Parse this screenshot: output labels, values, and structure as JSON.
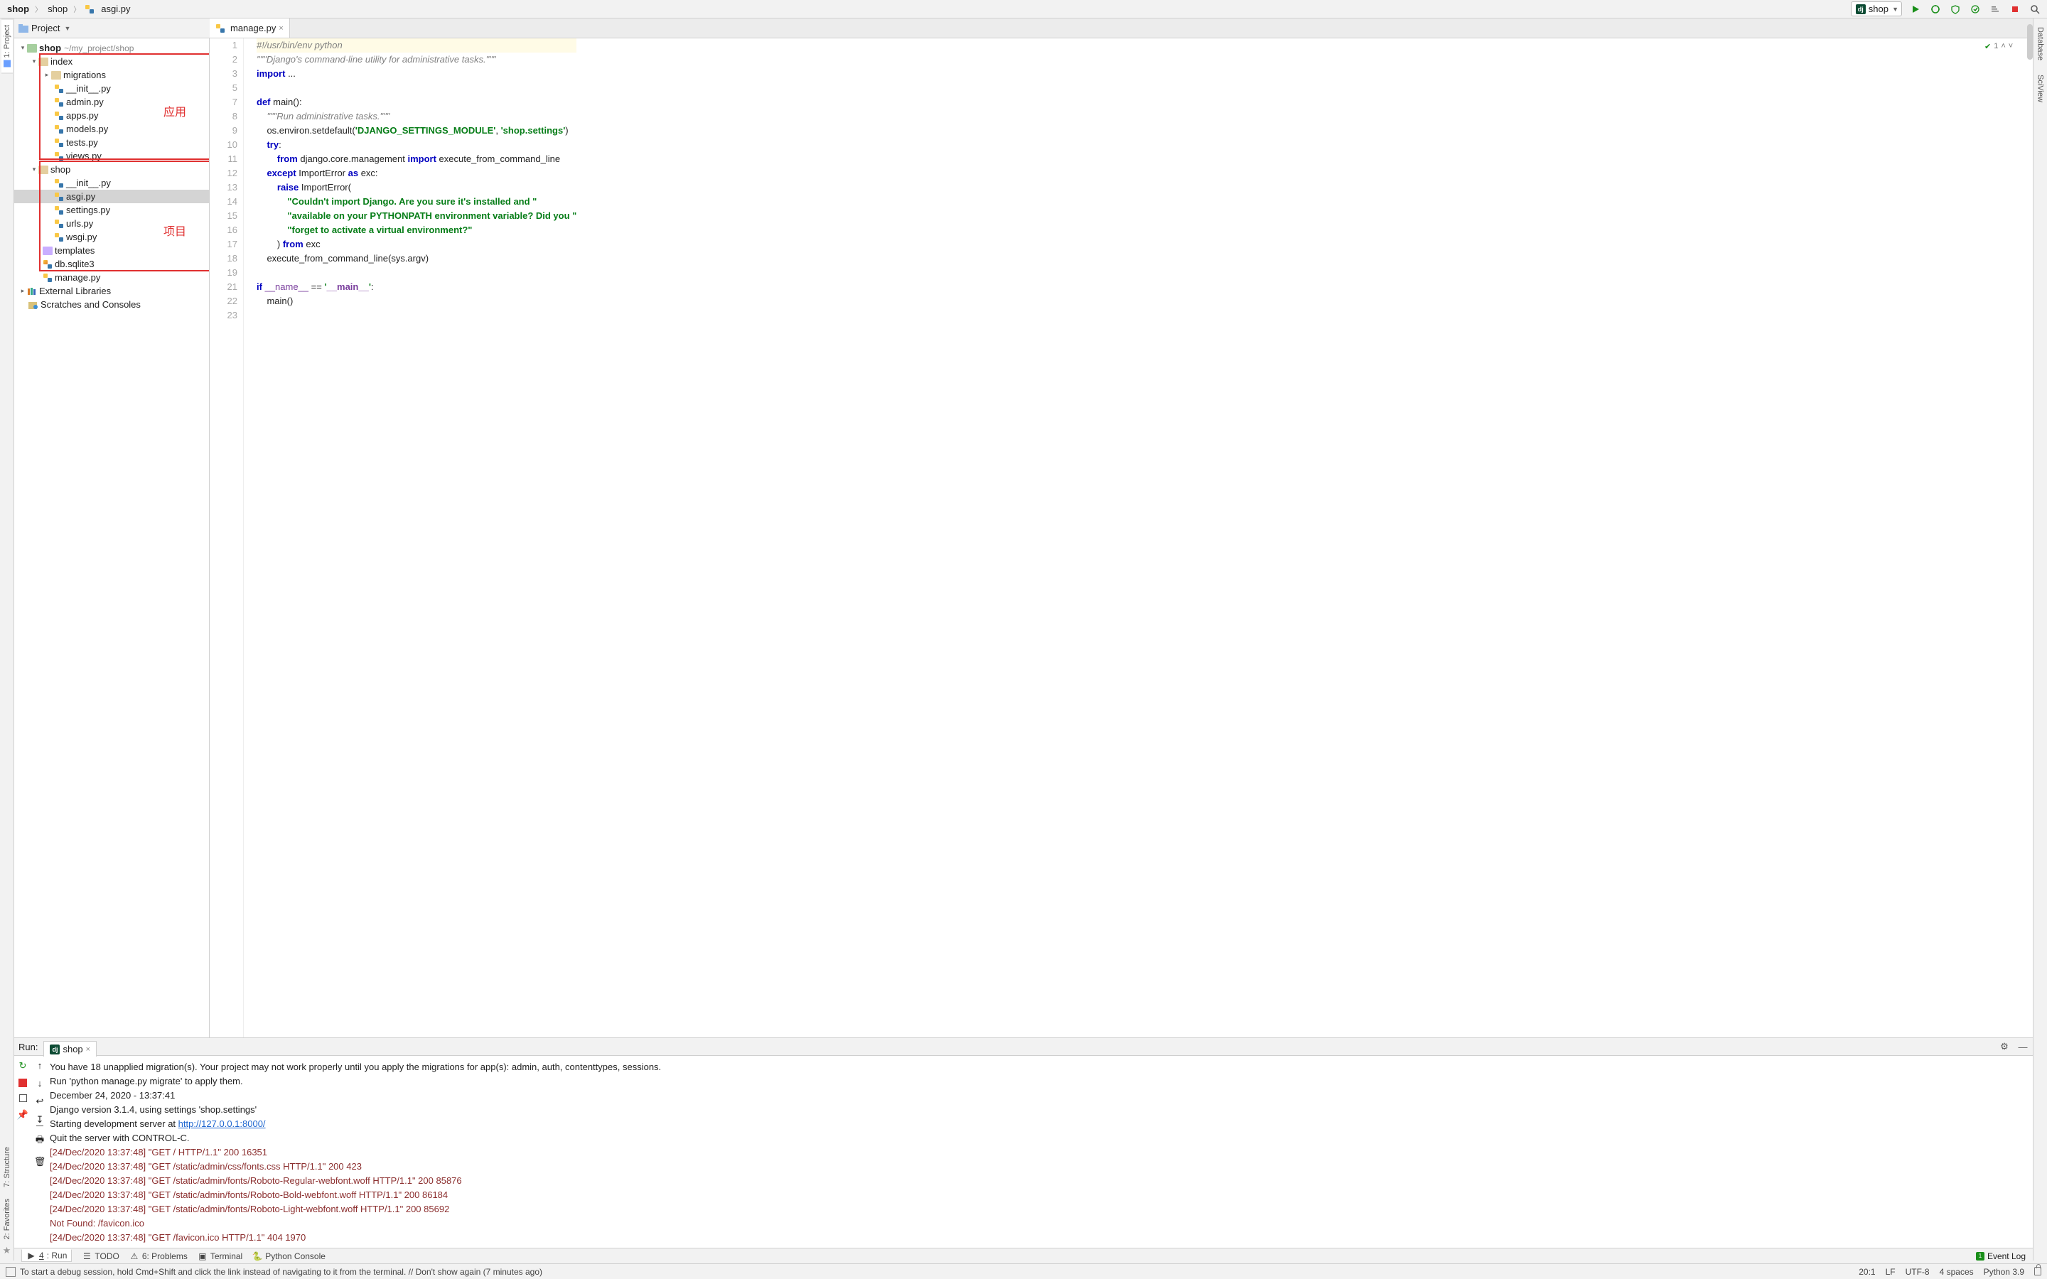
{
  "breadcrumbs": [
    "shop",
    "shop",
    "asgi.py"
  ],
  "topbar_icons": {
    "run_config": "shop",
    "run": "run-icon",
    "debug": "bug-icon",
    "coverage": "coverage-icon",
    "stop": "stop-icon",
    "git_update": "git-update-icon",
    "search": "search-icon",
    "cog": "cog-icon"
  },
  "project_header": {
    "label": "Project",
    "actions": {
      "target": "target",
      "collapse": "collapse",
      "settings": "gear",
      "hide": "hide"
    }
  },
  "tree": {
    "root": {
      "name": "shop",
      "path": "~/my_project/shop"
    },
    "index": {
      "name": "index",
      "files": [
        "migrations",
        "__init__.py",
        "admin.py",
        "apps.py",
        "models.py",
        "tests.py",
        "views.py"
      ]
    },
    "shop_pkg": {
      "name": "shop",
      "files": [
        "__init__.py",
        "asgi.py",
        "settings.py",
        "urls.py",
        "wsgi.py"
      ]
    },
    "templates": "templates",
    "db": "db.sqlite3",
    "manage": "manage.py",
    "external": "External Libraries",
    "scratches": "Scratches and Consoles"
  },
  "annotations": {
    "app": "应用",
    "project": "项目"
  },
  "editor": {
    "tab": "manage.py",
    "inspect_count": "1",
    "lines": [
      {
        "n": 1,
        "raw": "#!/usr/bin/env python",
        "cls": "curline cmt"
      },
      {
        "n": 2,
        "raw": "\"\"\"Django's command-line utility for administrative tasks.\"\"\"",
        "cls": "cmt"
      },
      {
        "n": 3,
        "raw": "import ...",
        "cls": "imp"
      },
      {
        "n": 5,
        "raw": ""
      },
      {
        "n": 7,
        "raw": "def main():",
        "cls": "def"
      },
      {
        "n": 8,
        "raw": "    \"\"\"Run administrative tasks.\"\"\"",
        "cls": "cmt"
      },
      {
        "n": 9,
        "raw": "    os.environ.setdefault('DJANGO_SETTINGS_MODULE', 'shop.settings')",
        "cls": "call"
      },
      {
        "n": 10,
        "raw": "    try:",
        "cls": "kw"
      },
      {
        "n": 11,
        "raw": "        from django.core.management import execute_from_command_line",
        "cls": "imp"
      },
      {
        "n": 12,
        "raw": "    except ImportError as exc:",
        "cls": "kw"
      },
      {
        "n": 13,
        "raw": "        raise ImportError(",
        "cls": "kw"
      },
      {
        "n": 14,
        "raw": "            \"Couldn't import Django. Are you sure it's installed and \"",
        "cls": "str"
      },
      {
        "n": 15,
        "raw": "            \"available on your PYTHONPATH environment variable? Did you \"",
        "cls": "str"
      },
      {
        "n": 16,
        "raw": "            \"forget to activate a virtual environment?\"",
        "cls": "str"
      },
      {
        "n": 17,
        "raw": "        ) from exc",
        "cls": "kw"
      },
      {
        "n": 18,
        "raw": "    execute_from_command_line(sys.argv)"
      },
      {
        "n": 19,
        "raw": ""
      },
      {
        "n": 21,
        "raw": "if __name__ == '__main__':",
        "cls": "mainchk"
      },
      {
        "n": 22,
        "raw": "    main()"
      },
      {
        "n": 23,
        "raw": ""
      }
    ]
  },
  "run": {
    "title": "Run:",
    "tab": "shop",
    "lines": [
      "You have 18 unapplied migration(s). Your project may not work properly until you apply the migrations for app(s): admin, auth, contenttypes, sessions.",
      "Run 'python manage.py migrate' to apply them.",
      "December 24, 2020 - 13:37:41",
      "Django version 3.1.4, using settings 'shop.settings'",
      "Starting development server at ",
      "Quit the server with CONTROL-C.",
      "[24/Dec/2020 13:37:48] \"GET / HTTP/1.1\" 200 16351",
      "[24/Dec/2020 13:37:48] \"GET /static/admin/css/fonts.css HTTP/1.1\" 200 423",
      "[24/Dec/2020 13:37:48] \"GET /static/admin/fonts/Roboto-Regular-webfont.woff HTTP/1.1\" 200 85876",
      "[24/Dec/2020 13:37:48] \"GET /static/admin/fonts/Roboto-Bold-webfont.woff HTTP/1.1\" 200 86184",
      "[24/Dec/2020 13:37:48] \"GET /static/admin/fonts/Roboto-Light-webfont.woff HTTP/1.1\" 200 85692",
      "Not Found: /favicon.ico",
      "[24/Dec/2020 13:37:48] \"GET /favicon.ico HTTP/1.1\" 404 1970"
    ],
    "server_url": "http://127.0.0.1:8000/"
  },
  "bottom_tabs": [
    "4: Run",
    "TODO",
    "6: Problems",
    "Terminal",
    "Python Console"
  ],
  "event_log_label": "Event Log",
  "status": {
    "hint": "To start a debug session, hold Cmd+Shift and click the link instead of navigating to it from the terminal. // Don't show again (7 minutes ago)",
    "cursor": "20:1",
    "line_sep": "LF",
    "encoding": "UTF-8",
    "indent": "4 spaces",
    "sdk": "Python 3.9"
  },
  "left_strip": {
    "project": "1: Project",
    "structure": "7: Structure",
    "favorites": "2: Favorites"
  },
  "right_strip": {
    "database": "Database",
    "sciview": "SciView"
  }
}
